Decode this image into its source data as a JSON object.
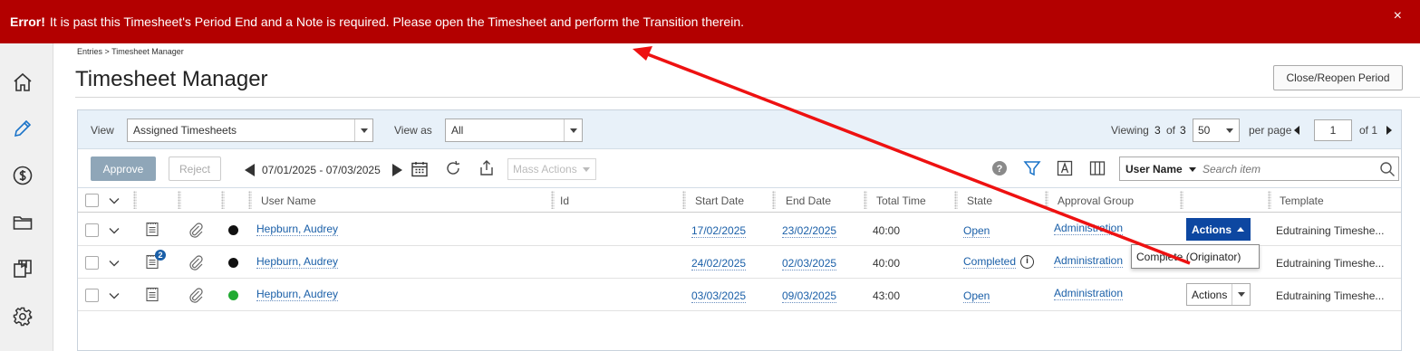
{
  "error": {
    "title": "Error!",
    "message": "It is past this Timesheet's Period End and a Note is required. Please open the Timesheet and perform the Transition therein.",
    "close": "×"
  },
  "nav": {
    "items": [
      "home-icon",
      "pencil-icon",
      "dollar-icon",
      "folder-icon",
      "copy-icon",
      "gear-icon"
    ]
  },
  "breadcrumb": "Entries > Timesheet Manager",
  "page_title": "Timesheet Manager",
  "close_period_label": "Close/Reopen Period",
  "filters": {
    "view_label": "View",
    "view_value": "Assigned Timesheets",
    "view_as_label": "View as",
    "view_as_value": "All"
  },
  "pager": {
    "viewing_label": "Viewing",
    "viewing_count": "3",
    "of_label": "of",
    "total": "3",
    "per_page_value": "50",
    "per_page_label": "per page",
    "page": "1",
    "of_pages": "of 1"
  },
  "toolbar": {
    "approve": "Approve",
    "reject": "Reject",
    "date_range": "07/01/2025 - 07/03/2025",
    "mass_actions": "Mass Actions",
    "search_field": "User Name",
    "search_placeholder": "Search item"
  },
  "columns": [
    "User Name",
    "Id",
    "Start Date",
    "End Date",
    "Total Time",
    "State",
    "Approval Group",
    "Template"
  ],
  "rows": [
    {
      "user": "Hepburn, Audrey",
      "id": "",
      "start": "17/02/2025",
      "end": "23/02/2025",
      "total": "40:00",
      "state": "Open",
      "group": "Administration",
      "template": "Edutraining Timeshe...",
      "actions": "Actions",
      "status_color": "#111111",
      "badge": ""
    },
    {
      "user": "Hepburn, Audrey",
      "id": "",
      "start": "24/02/2025",
      "end": "02/03/2025",
      "total": "40:00",
      "state": "Completed",
      "group": "Administration",
      "template": "Edutraining Timeshe...",
      "actions": "",
      "status_color": "#111111",
      "badge": "2"
    },
    {
      "user": "Hepburn, Audrey",
      "id": "",
      "start": "03/03/2025",
      "end": "09/03/2025",
      "total": "43:00",
      "state": "Open",
      "group": "Administration",
      "template": "Edutraining Timeshe...",
      "actions": "Actions",
      "status_color": "#22aa33",
      "badge": ""
    }
  ],
  "dropdown_item": "Complete (Originator)",
  "info_glyph": "i",
  "colors": {
    "error_bg": "#b30000",
    "link": "#1a5fa8",
    "actions_active": "#0d47a1",
    "annotation_arrow": "#ee1111"
  }
}
